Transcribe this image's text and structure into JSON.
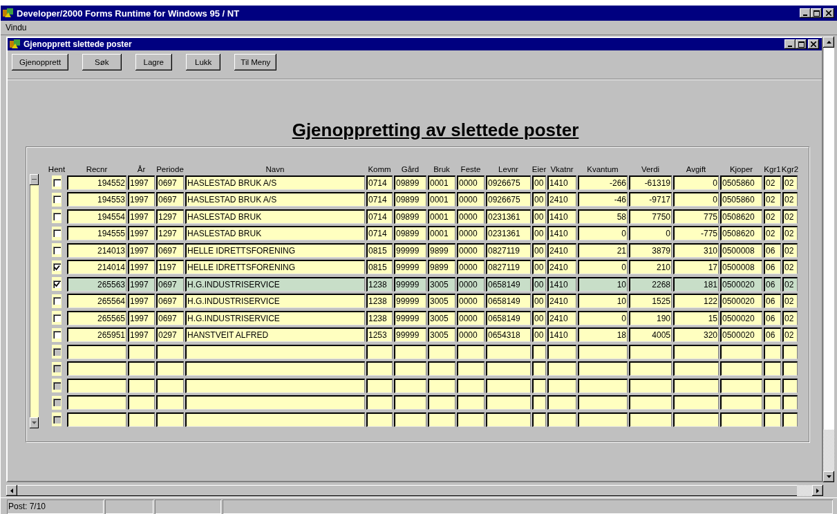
{
  "app_window": {
    "title": "Developer/2000 Forms Runtime for Windows 95 / NT"
  },
  "menu": [
    "Vindu"
  ],
  "form_window": {
    "title": "Gjenopprett slettede poster"
  },
  "buttons": [
    "Gjenopprett",
    "Søk",
    "Lagre",
    "Lukk",
    "Til Meny"
  ],
  "heading": "Gjenoppretting av slettede poster",
  "table": {
    "columns": [
      {
        "label": "Hent",
        "kind": "check"
      },
      {
        "label": "Recnr",
        "kind": "number"
      },
      {
        "label": "År",
        "kind": "text"
      },
      {
        "label": "Periode",
        "kind": "text"
      },
      {
        "label": "Navn",
        "kind": "text"
      },
      {
        "label": "Komm",
        "kind": "text"
      },
      {
        "label": "Gård",
        "kind": "text"
      },
      {
        "label": "Bruk",
        "kind": "text"
      },
      {
        "label": "Feste",
        "kind": "text"
      },
      {
        "label": "Levnr",
        "kind": "text"
      },
      {
        "label": "Eier",
        "kind": "text"
      },
      {
        "label": "Vkatnr",
        "kind": "text"
      },
      {
        "label": "Kvantum",
        "kind": "number"
      },
      {
        "label": "Verdi",
        "kind": "number"
      },
      {
        "label": "Avgift",
        "kind": "number"
      },
      {
        "label": "Kjoper",
        "kind": "text"
      },
      {
        "label": "Kgr1",
        "kind": "text"
      },
      {
        "label": "Kgr2",
        "kind": "text"
      }
    ],
    "rows": [
      {
        "hent": false,
        "selected": false,
        "disabled": false,
        "cells": [
          "194552",
          "1997",
          "0697",
          "HASLESTAD BRUK A/S",
          "0714",
          "09899",
          "0001",
          "0000",
          "0926675",
          "00",
          "1410",
          "-266",
          "-61319",
          "0",
          "0505860",
          "02",
          "02"
        ]
      },
      {
        "hent": false,
        "selected": false,
        "disabled": false,
        "cells": [
          "194553",
          "1997",
          "0697",
          "HASLESTAD BRUK A/S",
          "0714",
          "09899",
          "0001",
          "0000",
          "0926675",
          "00",
          "2410",
          "-46",
          "-9717",
          "0",
          "0505860",
          "02",
          "02"
        ]
      },
      {
        "hent": false,
        "selected": false,
        "disabled": false,
        "cells": [
          "194554",
          "1997",
          "1297",
          "HASLESTAD BRUK",
          "0714",
          "09899",
          "0001",
          "0000",
          "0231361",
          "00",
          "1410",
          "58",
          "7750",
          "775",
          "0508620",
          "02",
          "02"
        ]
      },
      {
        "hent": false,
        "selected": false,
        "disabled": false,
        "cells": [
          "194555",
          "1997",
          "1297",
          "HASLESTAD BRUK",
          "0714",
          "09899",
          "0001",
          "0000",
          "0231361",
          "00",
          "1410",
          "0",
          "0",
          "-775",
          "0508620",
          "02",
          "02"
        ]
      },
      {
        "hent": false,
        "selected": false,
        "disabled": false,
        "cells": [
          "214013",
          "1997",
          "0697",
          "HELLE IDRETTSFORENING",
          "0815",
          "99999",
          "9899",
          "0000",
          "0827119",
          "00",
          "2410",
          "21",
          "3879",
          "310",
          "0500008",
          "06",
          "02"
        ]
      },
      {
        "hent": true,
        "selected": false,
        "disabled": false,
        "cells": [
          "214014",
          "1997",
          "1197",
          "HELLE IDRETTSFORENING",
          "0815",
          "99999",
          "9899",
          "0000",
          "0827119",
          "00",
          "2410",
          "0",
          "210",
          "17",
          "0500008",
          "06",
          "02"
        ]
      },
      {
        "hent": true,
        "selected": true,
        "disabled": false,
        "cells": [
          "265563",
          "1997",
          "0697",
          "H.G.INDUSTRISERVICE",
          "1238",
          "99999",
          "3005",
          "0000",
          "0658149",
          "00",
          "1410",
          "10",
          "2268",
          "181",
          "0500020",
          "06",
          "02"
        ]
      },
      {
        "hent": false,
        "selected": false,
        "disabled": false,
        "cells": [
          "265564",
          "1997",
          "0697",
          "H.G.INDUSTRISERVICE",
          "1238",
          "99999",
          "3005",
          "0000",
          "0658149",
          "00",
          "2410",
          "10",
          "1525",
          "122",
          "0500020",
          "06",
          "02"
        ]
      },
      {
        "hent": false,
        "selected": false,
        "disabled": false,
        "cells": [
          "265565",
          "1997",
          "0697",
          "H.G.INDUSTRISERVICE",
          "1238",
          "99999",
          "3005",
          "0000",
          "0658149",
          "00",
          "2410",
          "0",
          "190",
          "15",
          "0500020",
          "06",
          "02"
        ]
      },
      {
        "hent": false,
        "selected": false,
        "disabled": false,
        "cells": [
          "265951",
          "1997",
          "0297",
          "HANSTVEIT ALFRED",
          "1253",
          "99999",
          "3005",
          "0000",
          "0654318",
          "00",
          "1410",
          "18",
          "4005",
          "320",
          "0500020",
          "06",
          "02"
        ]
      },
      {
        "hent": false,
        "selected": false,
        "disabled": true
      },
      {
        "hent": false,
        "selected": false,
        "disabled": true
      },
      {
        "hent": false,
        "selected": false,
        "disabled": true
      },
      {
        "hent": false,
        "selected": false,
        "disabled": true
      },
      {
        "hent": false,
        "selected": false,
        "disabled": true
      }
    ]
  },
  "status_bar": [
    "Post: 7/10"
  ]
}
